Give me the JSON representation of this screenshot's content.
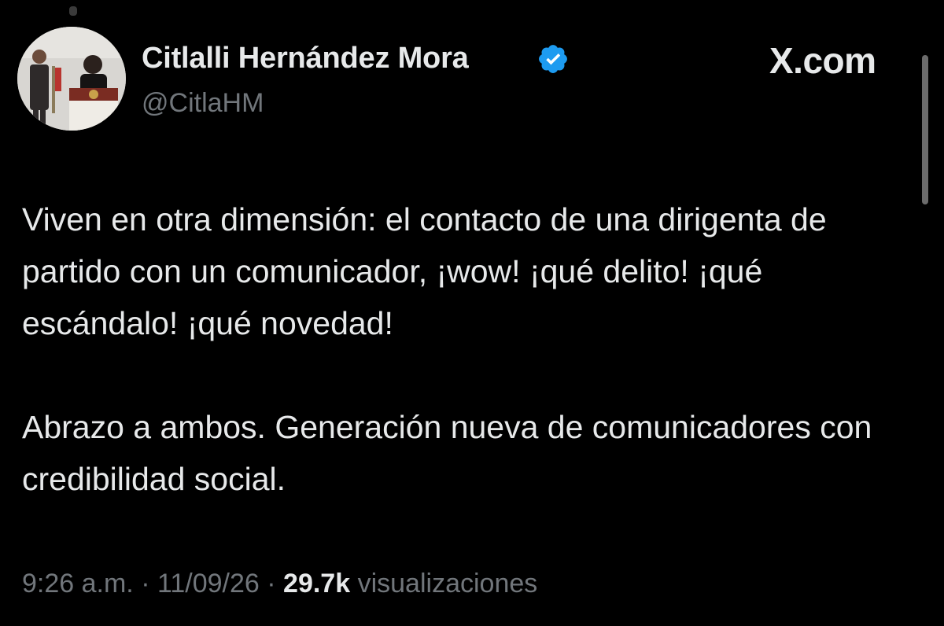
{
  "tweet": {
    "author": {
      "display_name": "Citlalli Hernández Mora",
      "handle": "@CitlaHM",
      "verified": true,
      "verified_color": "#1d9bf0"
    },
    "brand": "X.com",
    "paragraphs": [
      "Viven en otra dimensión: el contacto de una dirigenta de partido con un comunicador, ¡wow! ¡qué delito! ¡qué escándalo! ¡qué novedad!",
      "Abrazo a ambos. Generación nueva de comunicadores con credibilidad social."
    ],
    "meta": {
      "time": "9:26 a.m.",
      "separator": "·",
      "date": "11/09/26",
      "views_count": "29.7k",
      "views_label": "visualizaciones"
    }
  },
  "colors": {
    "background": "#000000",
    "primary_text": "#e7e9ea",
    "secondary_text": "#71767b"
  },
  "icons": {
    "avatar": "profile-photo",
    "verified": "verified-badge-icon"
  }
}
